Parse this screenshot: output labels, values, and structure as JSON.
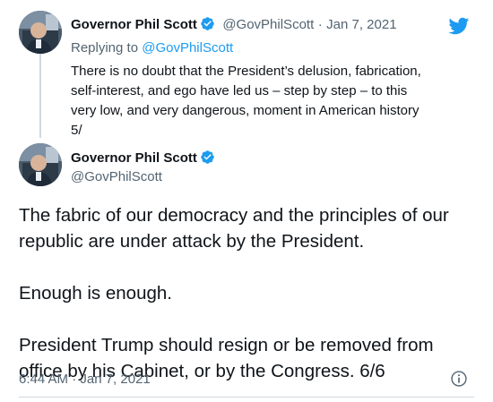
{
  "brand": {
    "twitter_blue": "#1d9bf0",
    "text_color": "#0f1419",
    "muted_color": "#536471",
    "logo_icon": "twitter-bird-icon"
  },
  "reply_tweet": {
    "display_name": "Governor Phil Scott",
    "verified": true,
    "handle": "@GovPhilScott",
    "separator": "·",
    "date": "Jan 7, 2021",
    "replying_prefix": "Replying to",
    "replying_to": "@GovPhilScott",
    "text": "There is no doubt that the President’s delusion, fabrication,\nself-interest, and ego have led us – step by step – to this\nvery low, and very dangerous, moment in American history\n5/"
  },
  "main_tweet": {
    "display_name": "Governor Phil Scott",
    "verified": true,
    "handle": "@GovPhilScott",
    "paragraphs": [
      "The fabric of our democracy and the principles of our republic are under attack by the President.",
      "Enough is enough.",
      "President Trump should resign or be removed from office by his Cabinet, or by the Congress. 6/6"
    ],
    "timestamp": "6:44 AM · Jan 7, 2021",
    "info_icon": "info-icon"
  }
}
